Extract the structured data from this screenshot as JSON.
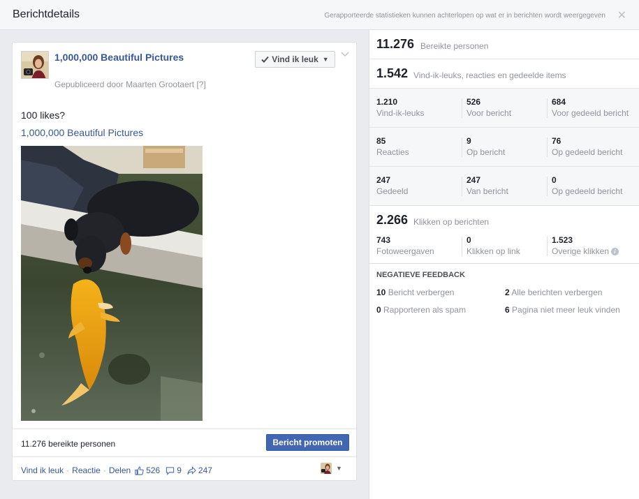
{
  "header": {
    "title": "Berichtdetails",
    "note": "Gerapporteerde statistieken kunnen achterlopen op wat er in berichten wordt weergegeven",
    "close": "✕"
  },
  "post": {
    "page_name": "1,000,000 Beautiful Pictures",
    "published_by": "Gepubliceerd door Maarten Grootaert [?]",
    "like_button": "Vind ik leuk",
    "text": "100 likes?",
    "link_text": "1,000,000 Beautiful Pictures",
    "reach": "11.276 bereikte personen",
    "promote": "Bericht promoten",
    "actions": {
      "like": "Vind ik leuk",
      "comment": "Reactie",
      "share": "Delen",
      "sep": "·"
    },
    "counts": {
      "likes": "526",
      "comments": "9",
      "shares": "247"
    }
  },
  "stats": {
    "reach": {
      "value": "11.276",
      "label": "Bereikte personen"
    },
    "engagement": {
      "value": "1.542",
      "label": "Vind-ik-leuks, reacties en gedeelde items"
    },
    "rows": [
      [
        {
          "value": "1.210",
          "label": "Vind-ik-leuks"
        },
        {
          "value": "526",
          "label": "Voor bericht"
        },
        {
          "value": "684",
          "label": "Voor gedeeld bericht"
        }
      ],
      [
        {
          "value": "85",
          "label": "Reacties"
        },
        {
          "value": "9",
          "label": "Op bericht"
        },
        {
          "value": "76",
          "label": "Op gedeeld bericht"
        }
      ],
      [
        {
          "value": "247",
          "label": "Gedeeld"
        },
        {
          "value": "247",
          "label": "Van bericht"
        },
        {
          "value": "0",
          "label": "Op gedeeld bericht"
        }
      ]
    ],
    "clicks": {
      "value": "2.266",
      "label": "Klikken op berichten",
      "items": [
        {
          "value": "743",
          "label": "Fotoweergaven"
        },
        {
          "value": "0",
          "label": "Klikken op link"
        },
        {
          "value": "1.523",
          "label": "Overige klikken"
        }
      ],
      "info": "i"
    },
    "negative": {
      "title": "NEGATIEVE FEEDBACK",
      "items": [
        {
          "value": "10",
          "label": "Bericht verbergen"
        },
        {
          "value": "2",
          "label": "Alle berichten verbergen"
        },
        {
          "value": "0",
          "label": "Rapporteren als spam"
        },
        {
          "value": "6",
          "label": "Pagina niet meer leuk vinden"
        }
      ]
    }
  }
}
